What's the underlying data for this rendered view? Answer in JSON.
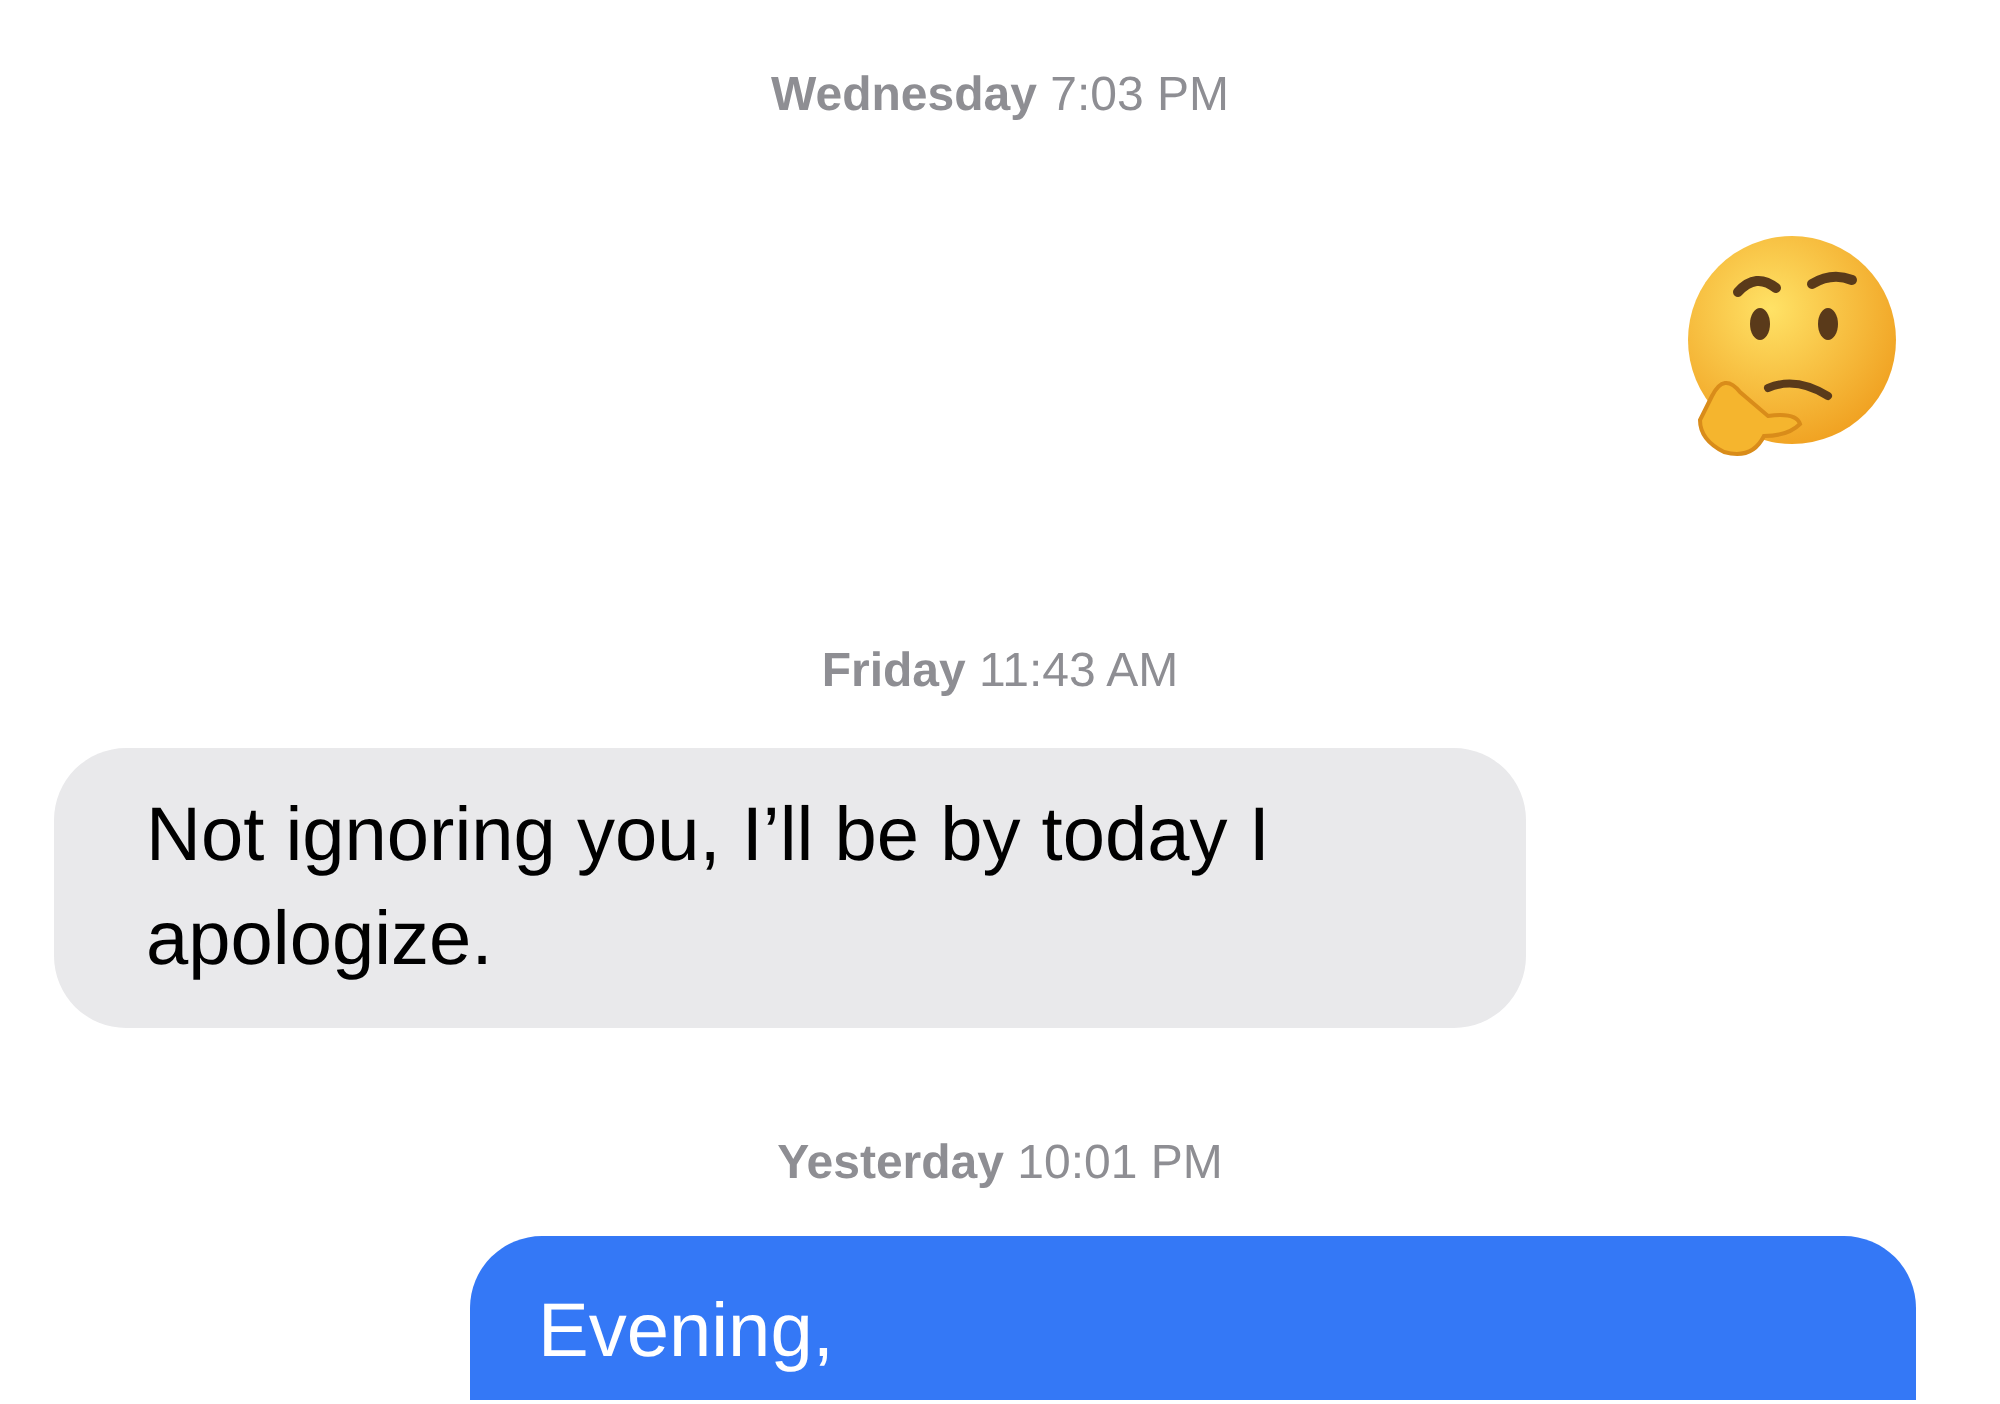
{
  "messages": [
    {
      "kind": "timestamp",
      "text": "**Wednesday** 7:03 PM"
    },
    {
      "kind": "emoji"
    },
    {
      "kind": "timestamp",
      "text": "**Friday** 11:43 AM"
    },
    {
      "kind": "incoming",
      "text": "Not ignoring you, I’ll be by today I apologize."
    },
    {
      "kind": "timestamp",
      "text": "**Yesterday** 10:01 PM"
    },
    {
      "kind": "outgoing",
      "text": "Evening,"
    }
  ]
}
